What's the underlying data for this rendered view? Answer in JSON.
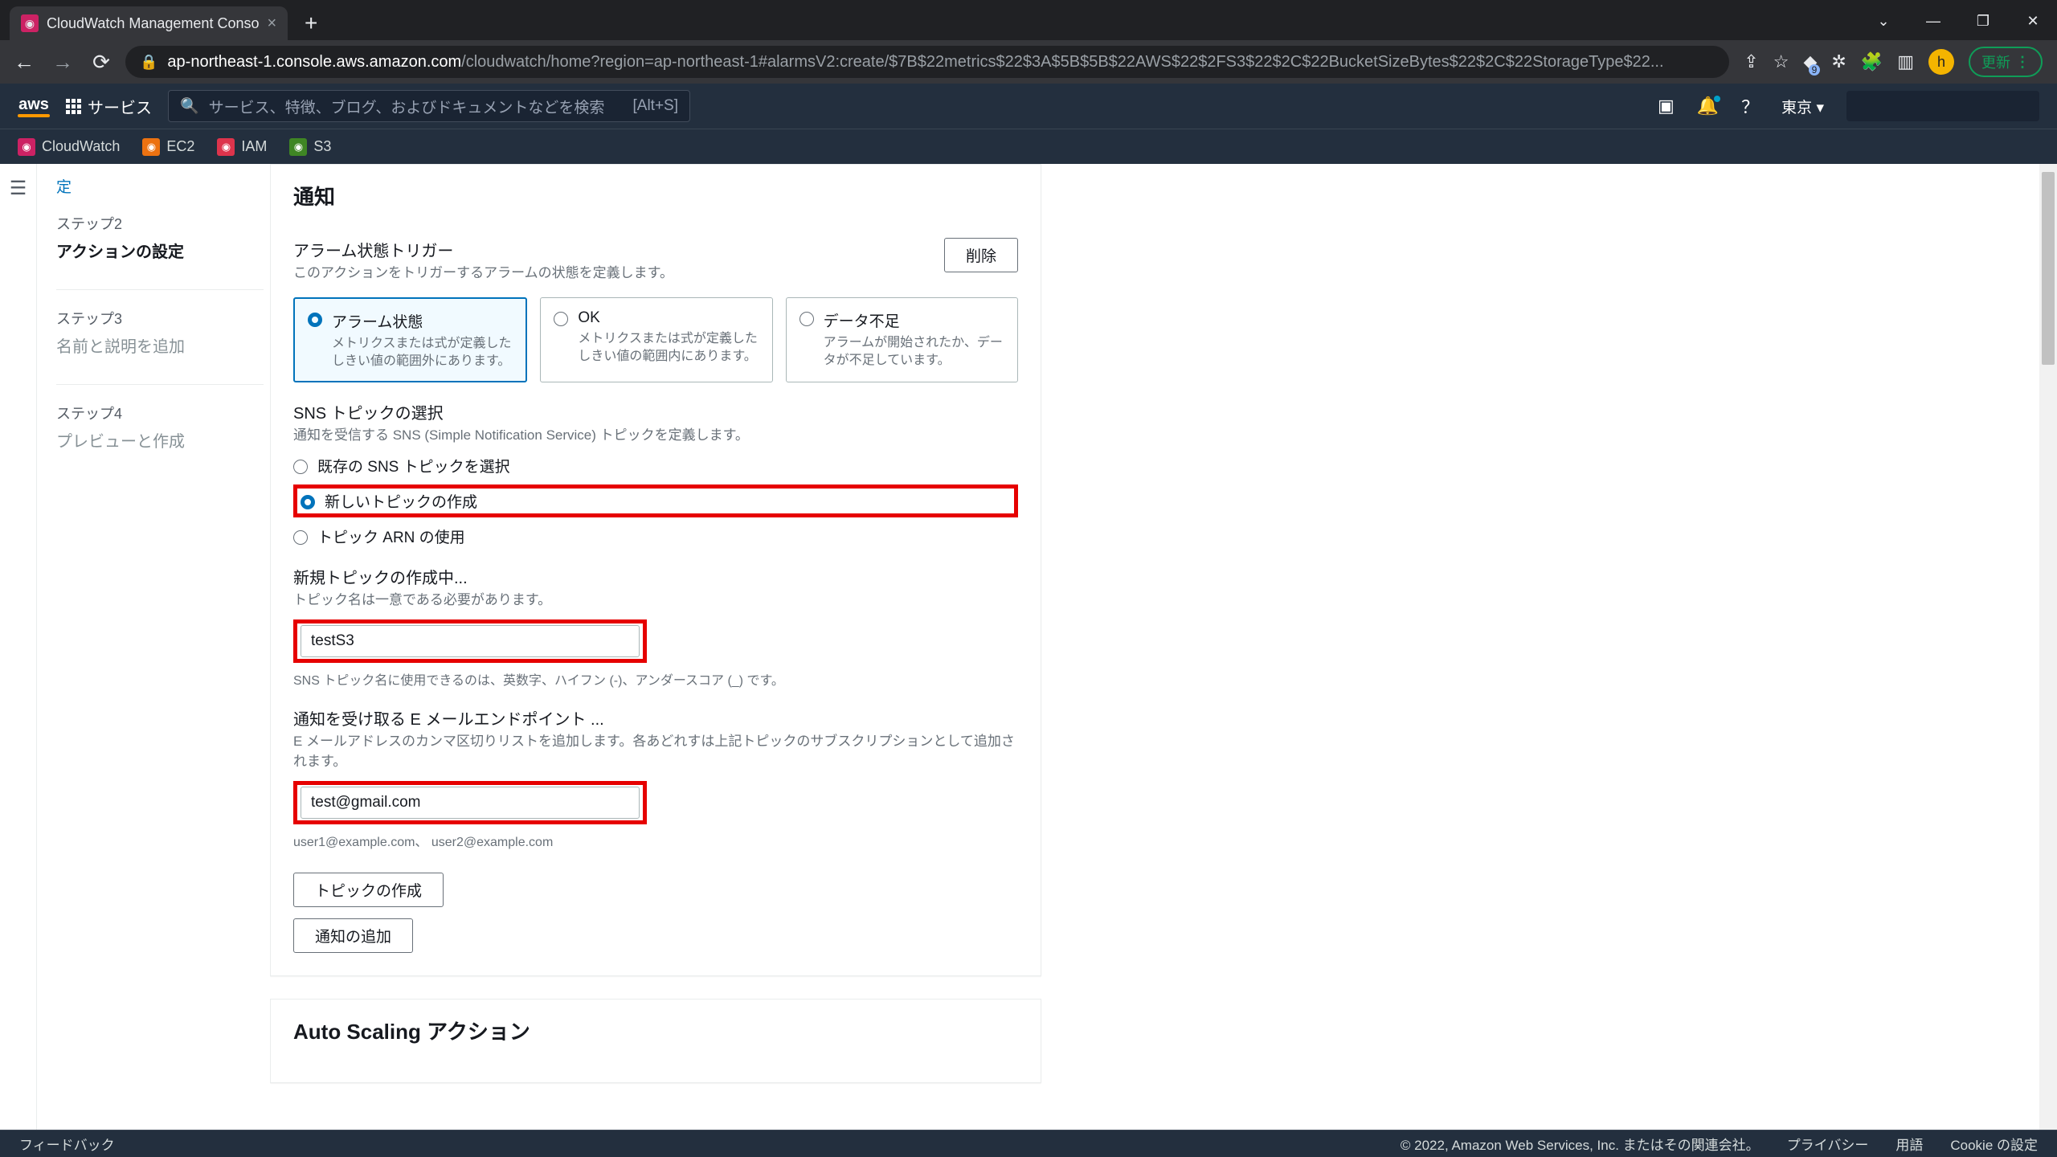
{
  "browser": {
    "tab_title": "CloudWatch Management Conso",
    "url_host": "ap-northeast-1.console.aws.amazon.com",
    "url_path": "/cloudwatch/home?region=ap-northeast-1#alarmsV2:create/$7B$22metrics$22$3A$5B$5B$22AWS$22$2FS3$22$2C$22BucketSizeBytes$22$2C$22StorageType$22...",
    "update_label": "更新"
  },
  "aws_header": {
    "services_label": "サービス",
    "search_placeholder": "サービス、特徴、ブログ、およびドキュメントなどを検索",
    "search_hint": "[Alt+S]",
    "region": "東京",
    "subnav": {
      "cloudwatch": "CloudWatch",
      "ec2": "EC2",
      "iam": "IAM",
      "s3": "S3"
    }
  },
  "steps": {
    "current_sub": "定",
    "s2_num": "ステップ2",
    "s2_title": "アクションの設定",
    "s3_num": "ステップ3",
    "s3_title": "名前と説明を追加",
    "s4_num": "ステップ4",
    "s4_title": "プレビューと作成"
  },
  "panel": {
    "heading": "通知",
    "trigger_label": "アラーム状態トリガー",
    "trigger_desc": "このアクションをトリガーするアラームの状態を定義します。",
    "delete_btn": "削除",
    "tiles": {
      "alarm": {
        "title": "アラーム状態",
        "desc": "メトリクスまたは式が定義したしきい値の範囲外にあります。"
      },
      "ok": {
        "title": "OK",
        "desc": "メトリクスまたは式が定義したしきい値の範囲内にあります。"
      },
      "insuf": {
        "title": "データ不足",
        "desc": "アラームが開始されたか、データが不足しています。"
      }
    },
    "sns_label": "SNS トピックの選択",
    "sns_desc": "通知を受信する SNS (Simple Notification Service) トピックを定義します。",
    "sns_opts": {
      "existing": "既存の SNS トピックを選択",
      "create": "新しいトピックの作成",
      "arn": "トピック ARN の使用"
    },
    "newtopic_label": "新規トピックの作成中...",
    "newtopic_desc": "トピック名は一意である必要があります。",
    "newtopic_value": "testS3",
    "newtopic_hint": "SNS トピック名に使用できるのは、英数字、ハイフン (-)、アンダースコア (_) です。",
    "email_label": "通知を受け取る E メールエンドポイント ...",
    "email_desc": "E メールアドレスのカンマ区切りリストを追加します。各あどれすは上記トピックのサブスクリプションとして追加されます。",
    "email_value": "test@gmail.com",
    "email_hint": "user1@example.com、 user2@example.com",
    "create_topic_btn": "トピックの作成",
    "add_notif_btn": "通知の追加",
    "autoscale_heading": "Auto Scaling アクション"
  },
  "footer": {
    "feedback": "フィードバック",
    "copyright": "© 2022, Amazon Web Services, Inc. またはその関連会社。",
    "privacy": "プライバシー",
    "terms": "用語",
    "cookies": "Cookie の設定"
  }
}
